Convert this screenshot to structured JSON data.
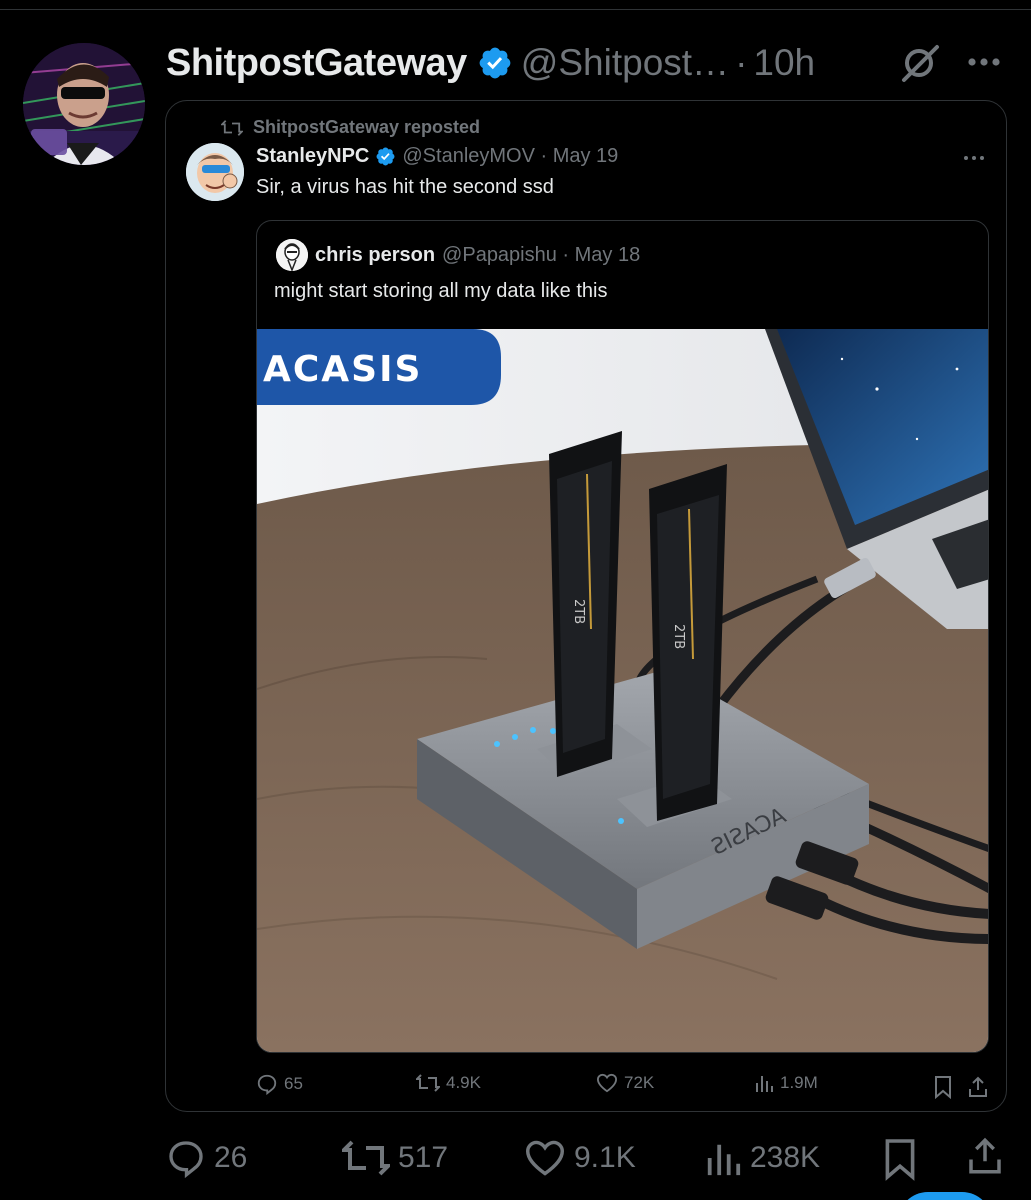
{
  "tweet": {
    "author_name": "ShitpostGateway",
    "author_handle": "@Shitpost…",
    "separator": "·",
    "time": "10h",
    "avatar_icon": "avatar-image",
    "grok_icon": "grok-icon",
    "more_icon": "more-icon"
  },
  "retweet": {
    "repost_label": "ShitpostGateway reposted",
    "author_name": "StanleyNPC",
    "meta": "@StanleyMOV · May 19",
    "text": "Sir, a virus has hit the second ssd",
    "quote": {
      "author_name": "chris person",
      "meta": "@Papapishu · May 18",
      "text": "might start storing all my data like this",
      "image_brand": "ACASIS",
      "image_labels": {
        "ssd_capacity": "2TB",
        "dock_brand": "ACASIS"
      }
    },
    "actions": {
      "replies": "65",
      "reposts": "4.9K",
      "likes": "72K",
      "views": "1.9M"
    }
  },
  "actions": {
    "replies": "26",
    "reposts": "517",
    "likes": "9.1K",
    "views": "238K"
  },
  "colors": {
    "background": "#000000",
    "text_primary": "#e7e9ea",
    "text_secondary": "#71767b",
    "verified": "#1d9bf0",
    "border": "#2f3336",
    "brand_banner": "#1e56a8"
  }
}
